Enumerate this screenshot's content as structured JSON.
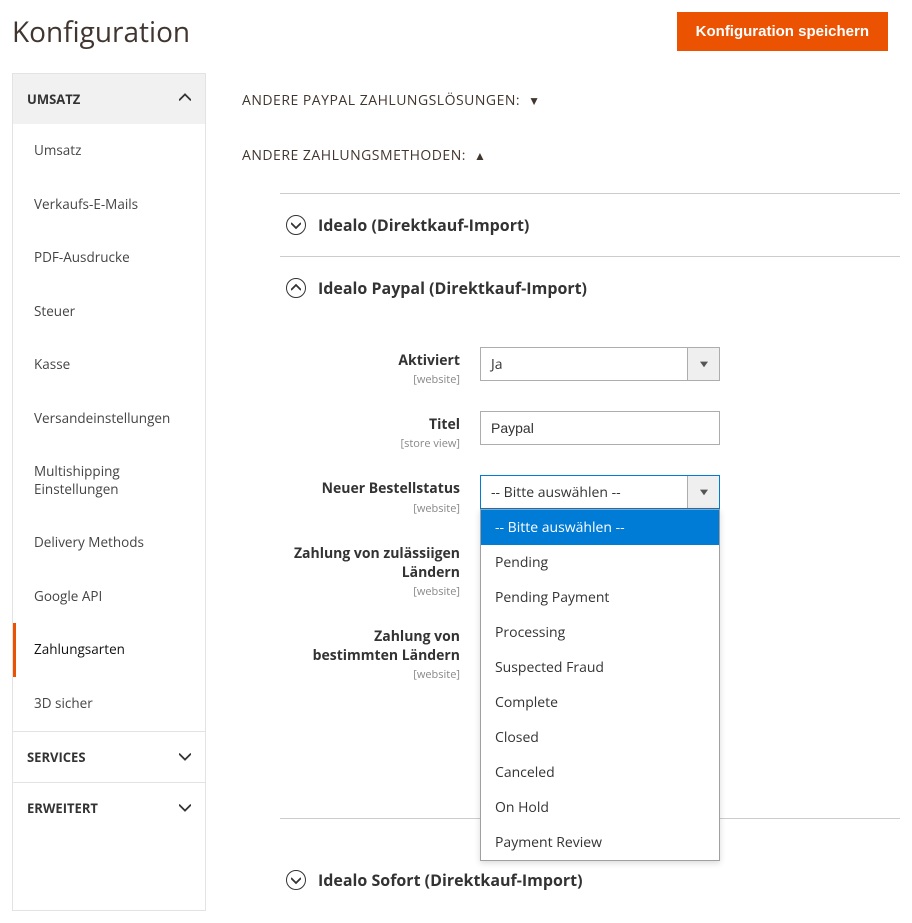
{
  "header": {
    "title": "Konfiguration",
    "save_button": "Konfiguration speichern"
  },
  "sidebar": {
    "groups": {
      "umsatz": {
        "label": "UMSATZ",
        "expanded": true
      },
      "services": {
        "label": "SERVICES",
        "expanded": false
      },
      "erweitert": {
        "label": "ERWEITERT",
        "expanded": false
      }
    },
    "items": [
      {
        "label": "Umsatz"
      },
      {
        "label": "Verkaufs-E-Mails"
      },
      {
        "label": "PDF-Ausdrucke"
      },
      {
        "label": "Steuer"
      },
      {
        "label": "Kasse"
      },
      {
        "label": "Versandeinstellungen"
      },
      {
        "label": "Multishipping Einstellungen"
      },
      {
        "label": "Delivery Methods"
      },
      {
        "label": "Google API"
      },
      {
        "label": "Zahlungsarten"
      },
      {
        "label": "3D sicher"
      }
    ]
  },
  "main": {
    "paypal_section": "ANDERE PAYPAL ZAHLUNGSLÖSUNGEN:",
    "other_section": "ANDERE ZAHLUNGSMETHODEN:",
    "accordions": {
      "idealo": "Idealo (Direktkauf-Import)",
      "idealo_paypal": "Idealo Paypal (Direktkauf-Import)",
      "idealo_sofort": "Idealo Sofort (Direktkauf-Import)"
    },
    "fields": {
      "aktiviert": {
        "label": "Aktiviert",
        "scope": "[website]",
        "value": "Ja"
      },
      "titel": {
        "label": "Titel",
        "scope": "[store view]",
        "value": "Paypal"
      },
      "bestellstatus": {
        "label": "Neuer Bestellstatus",
        "scope": "[website]",
        "value": "-- Bitte auswählen --"
      },
      "zulaessige": {
        "label": "Zahlung von zulässiigen Ländern",
        "scope": "[website]"
      },
      "bestimmte": {
        "label": "Zahlung von bestimmten Ländern",
        "scope": "[website]"
      }
    },
    "dropdown_options": [
      "-- Bitte auswählen --",
      "Pending",
      "Pending Payment",
      "Processing",
      "Suspected Fraud",
      "Complete",
      "Closed",
      "Canceled",
      "On Hold",
      "Payment Review"
    ]
  }
}
